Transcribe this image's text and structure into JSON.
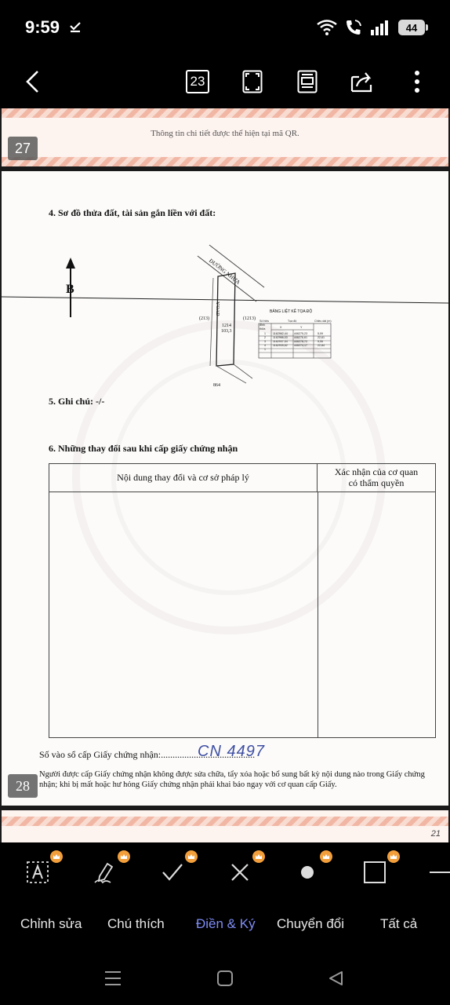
{
  "status_bar": {
    "time": "9:59",
    "battery": "44"
  },
  "toolbar": {
    "page_count": "23"
  },
  "document": {
    "page_27": {
      "number": "27",
      "qr_text": "Thông tin chi tiết được thể hiện tại mã QR."
    },
    "page_28": {
      "number": "28",
      "section4_title": "4. Sơ đồ thửa đất, tài sản gắn liền với đất:",
      "section5_title": "5. Ghi chú: -/-",
      "section6_title": "6. Những thay đổi sau khi cấp giấy chứng nhận",
      "map": {
        "north_label": "B",
        "road_label": "ĐƯỜNG NHỰA",
        "alley_label": "Y'OAD",
        "parcel_left": "(213)",
        "parcel_id": "1214",
        "parcel_area": "103,3",
        "parcel_right": "(1213)",
        "bottom_label": "864",
        "coord_table": {
          "title": "BẢNG LIỆT KÊ TỌA ĐỘ",
          "headers": [
            "Số hiệu đỉnh thửa",
            "Tọa độ",
            "Chiều dài (m)"
          ],
          "subheaders": [
            "X",
            "Y"
          ],
          "rows": [
            [
              "1",
              "1162962,44",
              "446275,23",
              "5,09"
            ],
            [
              "2",
              "1162966,03",
              "446276,61",
              "22,61"
            ],
            [
              "3",
              "1162937,54",
              "446278,72",
              "5,06"
            ],
            [
              "4",
              "1162935,62",
              "446274,17",
              "22,84"
            ],
            [
              "1",
              "",
              "",
              ""
            ]
          ]
        }
      },
      "table": {
        "col1_header": "Nội dung thay đổi và cơ sở pháp lý",
        "col2_header_line1": "Xác nhận của cơ quan",
        "col2_header_line2": "có thẩm quyền"
      },
      "cert_label": "Số vào sổ cấp Giấy chứng nhận:",
      "cert_dots": "........................................",
      "cert_number": "CN 4497",
      "note": "Người được cấp Giấy chứng nhận không được sửa chữa, tẩy xóa hoặc bổ sung bất kỳ nội dung nào trong Giấy chứng nhận; khi bị mất hoặc hư hỏng Giấy chứng nhận phải khai báo ngay với cơ quan cấp Giấy."
    },
    "page_29": {
      "corner_mark": "21"
    }
  },
  "tabs": [
    {
      "label": "Chỉnh sửa"
    },
    {
      "label": "Chú thích"
    },
    {
      "label": "Điền & Ký"
    },
    {
      "label": "Chuyển đổi"
    },
    {
      "label": "Tất cả"
    }
  ],
  "colors": {
    "active_tab": "#7f8df5",
    "premium_badge": "#f29f3b",
    "page_border": "#f1b7a4"
  }
}
